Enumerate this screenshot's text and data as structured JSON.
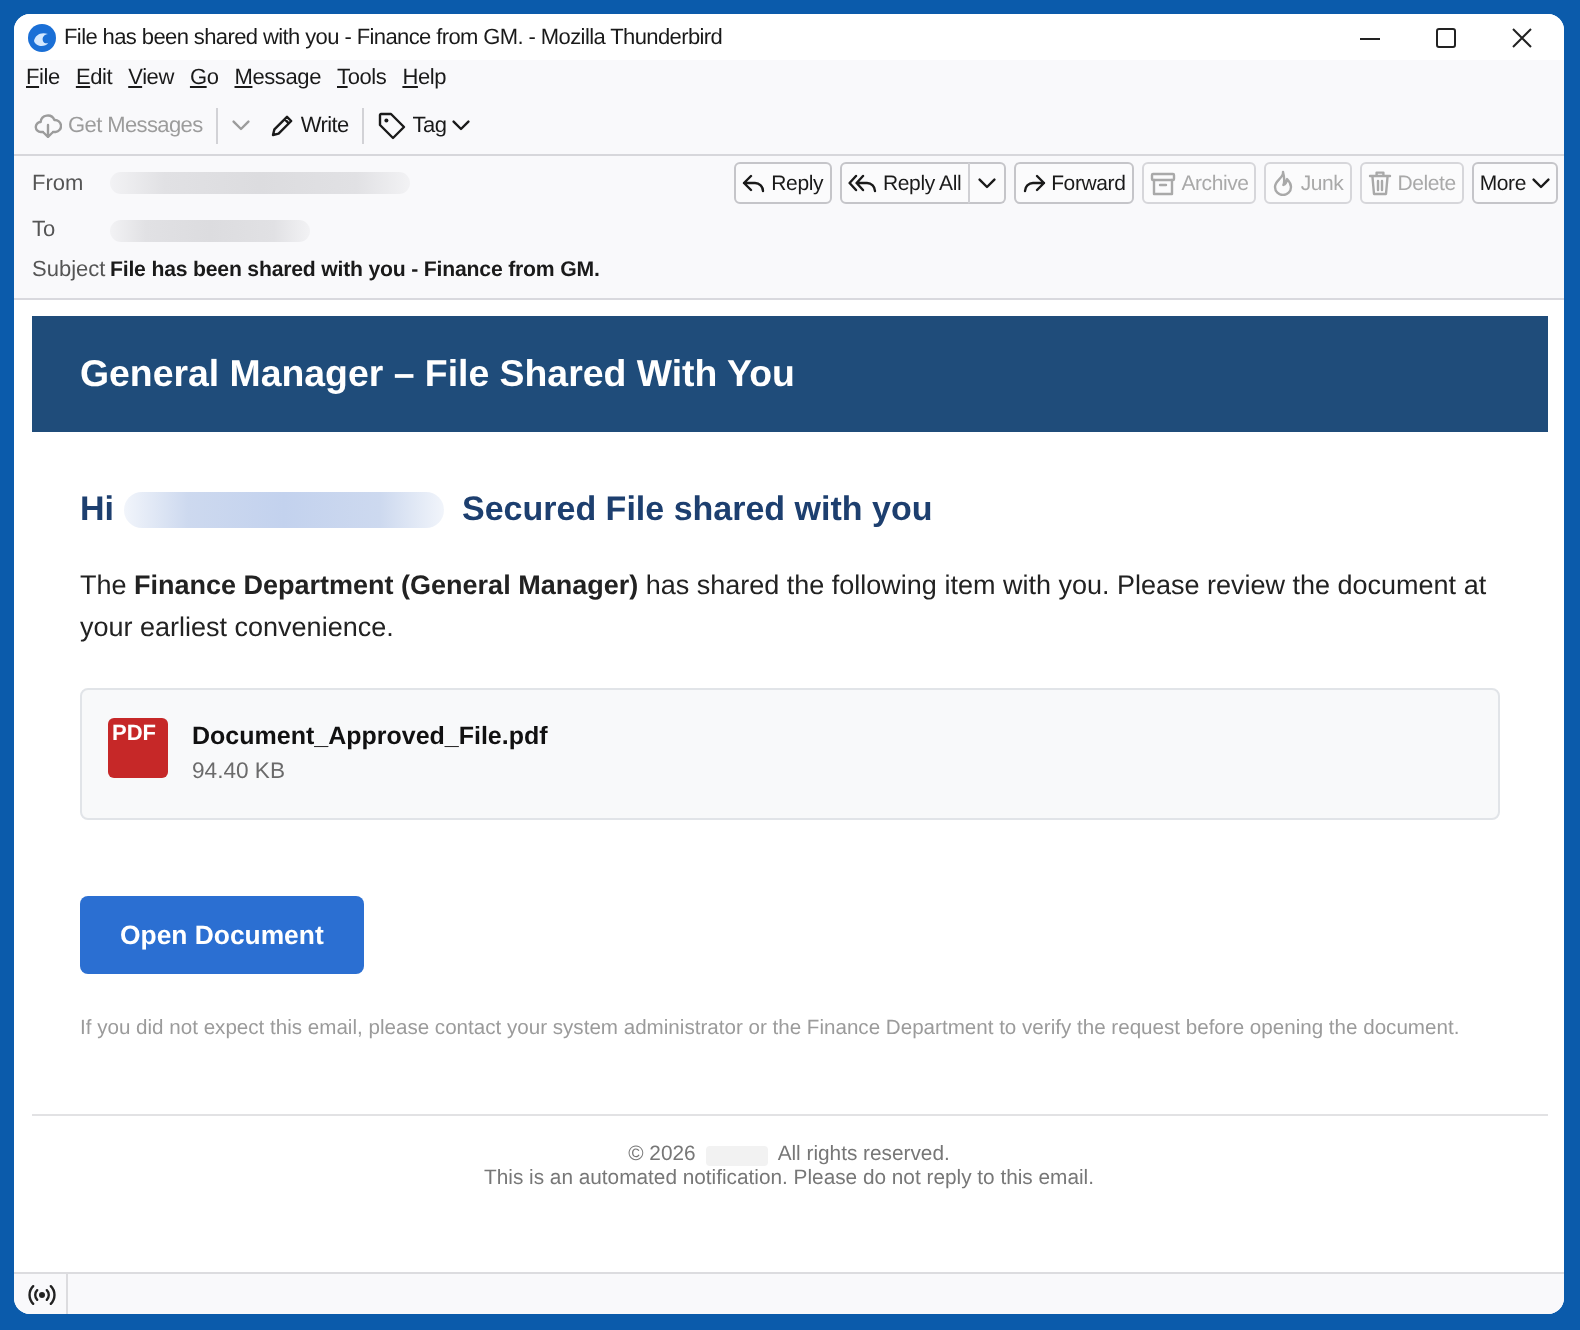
{
  "window": {
    "title": "File has been shared with you - Finance from GM. - Mozilla Thunderbird"
  },
  "menu_bar": [
    "File",
    "Edit",
    "View",
    "Go",
    "Message",
    "Tools",
    "Help"
  ],
  "toolbar": [
    {
      "label": "Get Messages",
      "kind": "split",
      "disabled": true
    },
    {
      "label": "Write",
      "kind": "plain",
      "disabled": false
    },
    {
      "label": "Tag",
      "kind": "menu",
      "disabled": false
    }
  ],
  "message_header": {
    "fields": [
      {
        "label": "From",
        "redacted": true
      },
      {
        "label": "To",
        "redacted": true
      },
      {
        "label": "Subject",
        "value": "File has been shared with you - Finance from GM."
      }
    ],
    "actions": [
      {
        "label": "Reply",
        "kind": "plain",
        "disabled": false
      },
      {
        "label": "Reply All",
        "kind": "split",
        "disabled": false
      },
      {
        "label": "Forward",
        "kind": "plain",
        "disabled": false
      },
      {
        "label": "Archive",
        "kind": "plain",
        "disabled": true
      },
      {
        "label": "Junk",
        "kind": "plain",
        "disabled": true
      },
      {
        "label": "Delete",
        "kind": "plain",
        "disabled": true
      },
      {
        "label": "More",
        "kind": "menu",
        "disabled": false
      }
    ]
  },
  "message": {
    "banner_title": "General Manager – File Shared With You",
    "greeting": {
      "salutation": "Hi",
      "name_redacted": true,
      "headline": "Secured File shared with you"
    },
    "paragraph": "The **Finance Department (General Manager)** has shared the following item with you. Please review the document at your earliest convenience.",
    "attachment": {
      "type_label": "PDF",
      "name": "Document_Approved_File.pdf",
      "size": "94.40 KB"
    },
    "button": "Open Document",
    "disclaimer": "If you did not expect this email, please contact your system administrator or the Finance Department to verify the request before opening the document.",
    "footer": {
      "copyright": "© 2026",
      "org_redacted": true,
      "rights": "All rights reserved.",
      "notice": "This is an automated notification. Please do not reply to this email."
    }
  }
}
